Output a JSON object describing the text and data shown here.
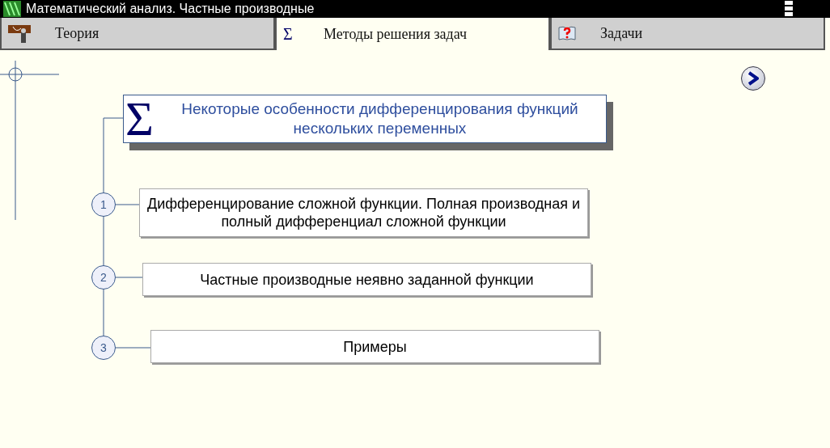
{
  "window": {
    "title": "Математический анализ. Частные производные"
  },
  "tabs": [
    {
      "label": "Теория",
      "selected": false,
      "kind": "teacher"
    },
    {
      "label": "Методы решения задач",
      "selected": true,
      "kind": "symbol",
      "symbol": "Σ"
    },
    {
      "label": "Задачи",
      "selected": false,
      "kind": "book"
    }
  ],
  "header": {
    "symbol": "Σ",
    "title": "Некоторые особенности дифференцирования функций нескольких переменных"
  },
  "topics": [
    {
      "number": "1",
      "label": "Дифференцирование сложной функции. Полная производная и полный дифференциал сложной функции"
    },
    {
      "number": "2",
      "label": "Частные производные неявно заданной функции"
    },
    {
      "number": "3",
      "label": "Примеры"
    }
  ]
}
